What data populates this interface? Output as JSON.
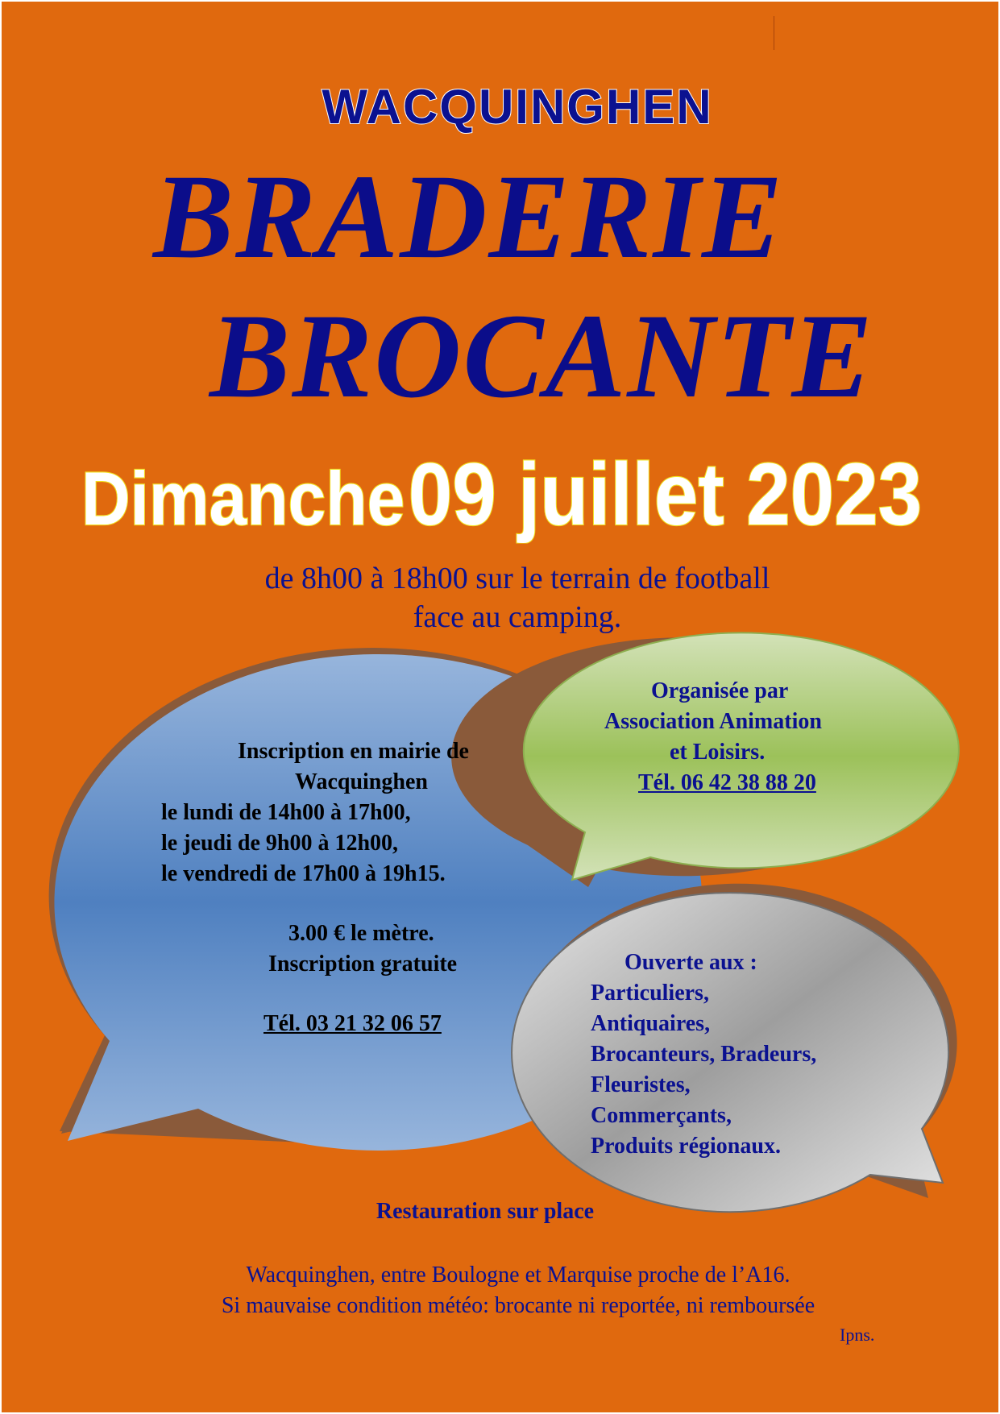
{
  "header": {
    "town": "WACQUINGHEN",
    "title_line1": "BRADERIE",
    "title_line2": "BROCANTE",
    "date_day": "Dimanche",
    "date_rest": "09 juillet 2023"
  },
  "location": {
    "line1": "de 8h00 à 18h00 sur le terrain de football",
    "line2": "face au camping."
  },
  "bubble_blue": {
    "lines": [
      "Inscription en mairie de",
      "Wacquinghen",
      "le lundi de 14h00 à 17h00,",
      "le jeudi de 9h00 à 12h00,",
      "le vendredi de 17h00 à 19h15.",
      "3.00 € le mètre.",
      "Inscription gratuite",
      "Tél.  03 21 32 06 57"
    ]
  },
  "bubble_green": {
    "lines": [
      "Organisée par",
      "Association Animation",
      "et Loisirs.",
      "Tél.  06 42 38 88 20"
    ]
  },
  "bubble_grey": {
    "lines": [
      "Ouverte aux :",
      "Particuliers,",
      "Antiquaires,",
      "Brocanteurs, Bradeurs,",
      "Fleuristes,",
      "Commerçants,",
      "Produits régionaux."
    ]
  },
  "footer": {
    "restauration": "Restauration sur place",
    "info_line1": "Wacquinghen, entre Boulogne et Marquise proche de l’A16.",
    "info_line2": "Si mauvaise condition météo: brocante ni reportée, ni remboursée",
    "ipns": "Ipns."
  },
  "colors": {
    "background": "#E0690E",
    "title_blue": "#0B0D8A",
    "text_navy": "#0B1190",
    "date_fill": "#FFFFFF",
    "date_outline": "#F2E11E",
    "bubble_blue": "#5A86C3",
    "bubble_green": "#9CC15A",
    "bubble_grey": "#B8B8B8"
  }
}
